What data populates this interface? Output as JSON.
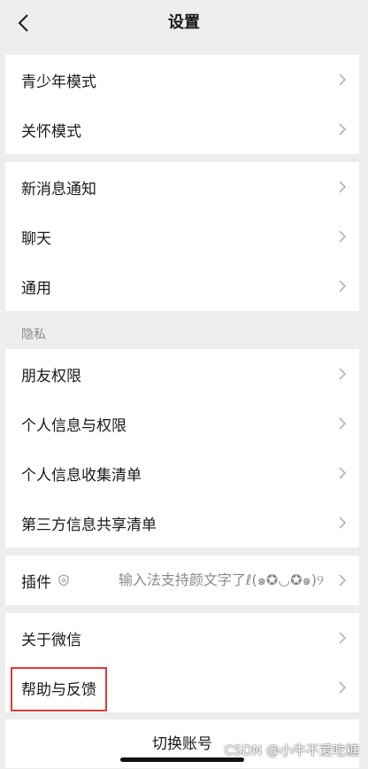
{
  "header": {
    "title": "设置",
    "back_icon": "chevron-left-icon"
  },
  "group1": [
    "青少年模式",
    "关怀模式"
  ],
  "group2": [
    "新消息通知",
    "聊天",
    "通用"
  ],
  "privacy": {
    "label": "隐私",
    "items": [
      "朋友权限",
      "个人信息与权限",
      "个人信息收集清单",
      "第三方信息共享清单"
    ]
  },
  "plugins": {
    "label": "插件",
    "icon": "shield-icon",
    "value": "输入法支持颜文字了ℓ(๑✪◡✪๑)୨"
  },
  "group5": [
    "关于微信",
    "帮助与反馈"
  ],
  "switch_account": "切换账号",
  "watermark": "CSDN @小牛不爱吃糖",
  "colors": {
    "background": "#ededed",
    "card": "#ffffff",
    "highlight": "#e53935",
    "secondary": "#8a8a8a"
  }
}
